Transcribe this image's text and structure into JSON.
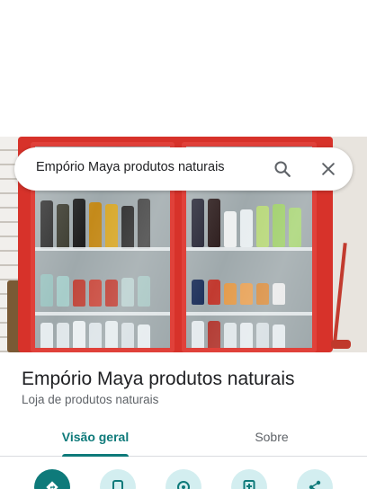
{
  "search": {
    "query": "Empório Maya produtos naturais"
  },
  "place": {
    "name": "Empório Maya produtos naturais",
    "category": "Loja de produtos naturais"
  },
  "tabs": [
    {
      "label": "Visão geral",
      "selected": true
    },
    {
      "label": "Sobre",
      "selected": false
    }
  ],
  "actions": [
    {
      "icon": "directions-icon"
    },
    {
      "icon": "phone-icon"
    },
    {
      "icon": "nearby-icon"
    },
    {
      "icon": "save-icon"
    },
    {
      "icon": "share-icon"
    }
  ],
  "colors": {
    "accent": "#0e7a7a",
    "action_bg": "#d3eef0",
    "fridge_red": "#d7322a"
  }
}
